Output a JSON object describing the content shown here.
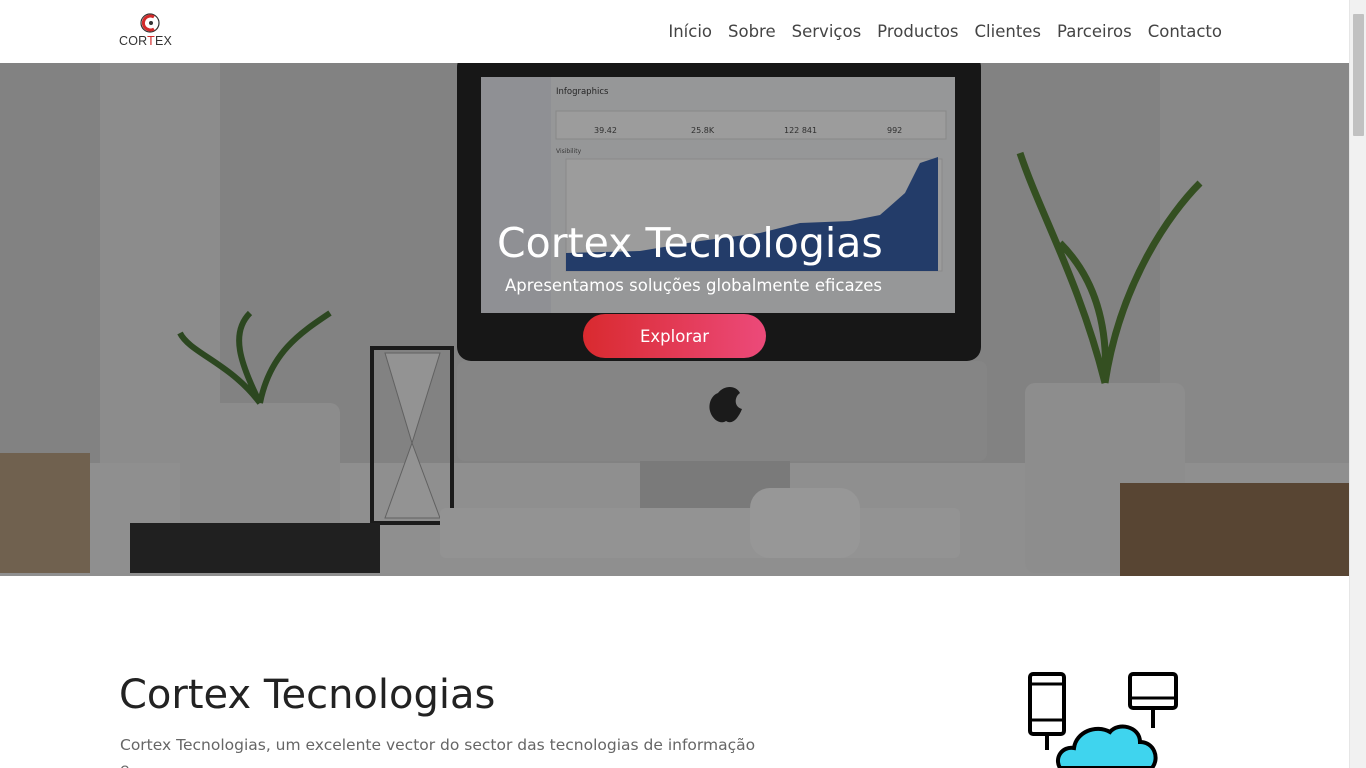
{
  "brand": {
    "logo_text_prefix": "COR",
    "logo_text_x": "T",
    "logo_text_suffix": "EX",
    "accent": "#d92a2f",
    "accent_end": "#ec4a7a"
  },
  "nav": {
    "items": [
      {
        "label": "Início"
      },
      {
        "label": "Sobre"
      },
      {
        "label": "Serviços"
      },
      {
        "label": "Productos"
      },
      {
        "label": "Clientes"
      },
      {
        "label": "Parceiros"
      },
      {
        "label": "Contacto"
      }
    ]
  },
  "hero": {
    "title": "Cortex Tecnologias",
    "subtitle": "Apresentamos soluções globalmente eficazes",
    "button_label": "Explorar",
    "screen": {
      "heading": "Infographics",
      "section": "Visibility",
      "stats": [
        "39.42",
        "25.8K",
        "122 841",
        "992"
      ]
    }
  },
  "about": {
    "title": "Cortex Tecnologias",
    "text": "Cortex Tecnologias, um excelente vector do sector das tecnologias de informação e"
  },
  "icons": [
    "cortex-logo-icon",
    "network-cloud-icon"
  ]
}
